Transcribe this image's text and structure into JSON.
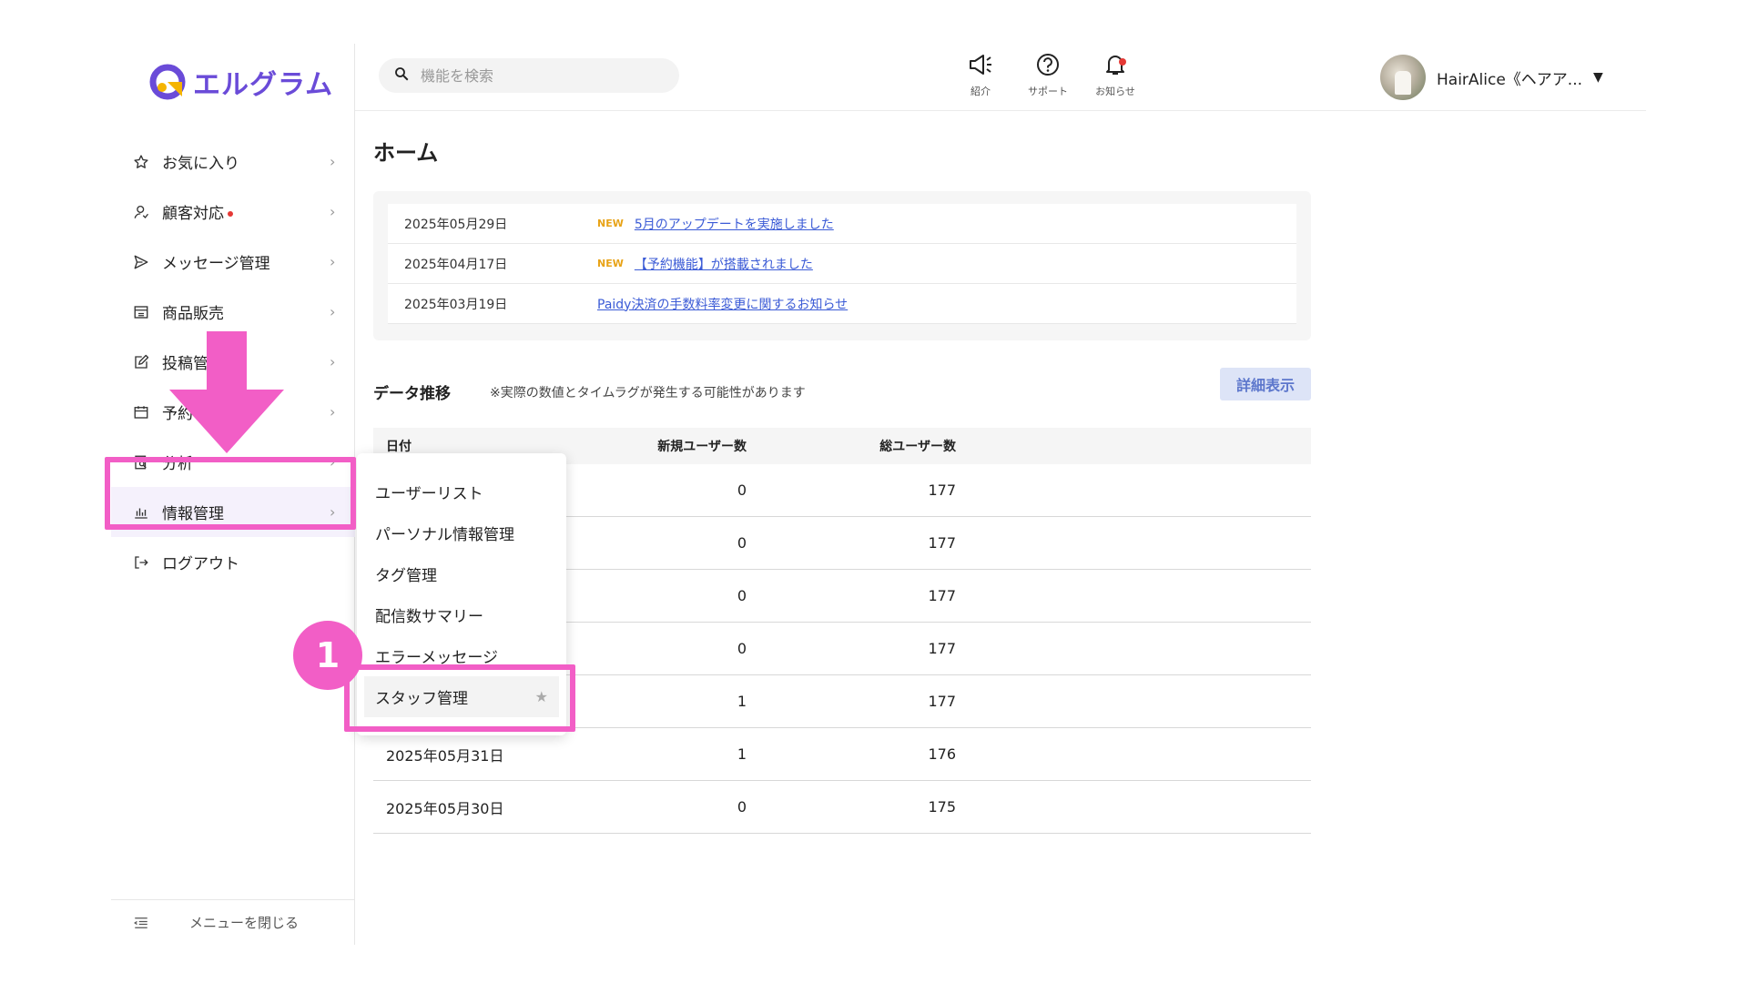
{
  "app": {
    "logo_text": "エルグラム",
    "brand_color": "#6a4bd8"
  },
  "sidebar": {
    "items": [
      {
        "label": "お気に入り",
        "icon": "star-icon"
      },
      {
        "label": "顧客対応",
        "icon": "person-icon",
        "badge": true
      },
      {
        "label": "メッセージ管理",
        "icon": "send-icon"
      },
      {
        "label": "商品販売",
        "icon": "store-icon"
      },
      {
        "label": "投稿管",
        "icon": "edit-icon"
      },
      {
        "label": "予約",
        "icon": "calendar-icon"
      },
      {
        "label": "分析",
        "icon": "report-icon"
      },
      {
        "label": "情報管理",
        "icon": "bar-chart-icon",
        "active": true
      },
      {
        "label": "ログアウト",
        "icon": "logout-icon"
      }
    ],
    "collapse_label": "メニューを閉じる"
  },
  "header": {
    "search_placeholder": "機能を検索",
    "buttons": [
      {
        "label": "紹介",
        "icon": "megaphone-icon"
      },
      {
        "label": "サポート",
        "icon": "help-icon"
      },
      {
        "label": "お知らせ",
        "icon": "bell-icon",
        "has_dot": true
      }
    ],
    "user_name": "HairAlice《ヘアア..."
  },
  "main": {
    "title": "ホーム",
    "news": [
      {
        "date": "2025年05月29日",
        "new": "NEW",
        "title": "5月のアップデートを実施しました"
      },
      {
        "date": "2025年04月17日",
        "new": "NEW",
        "title": "【予約機能】が搭載されました"
      },
      {
        "date": "2025年03月19日",
        "new": "",
        "title": "Paidy決済の手数料率変更に関するお知らせ"
      }
    ],
    "trend_title": "データ推移",
    "trend_note": "※実際の数値とタイムラグが発生する可能性があります",
    "detail_button": "詳細表示",
    "table": {
      "headers": [
        "日付",
        "新規ユーザー数",
        "総ユーザー数"
      ],
      "rows": [
        [
          "",
          "0",
          "177"
        ],
        [
          "",
          "0",
          "177"
        ],
        [
          "",
          "0",
          "177"
        ],
        [
          "",
          "0",
          "177"
        ],
        [
          "",
          "1",
          "177"
        ],
        [
          "2025年05月31日",
          "1",
          "176"
        ],
        [
          "2025年05月30日",
          "0",
          "175"
        ]
      ]
    }
  },
  "flyout": {
    "items": [
      "ユーザーリスト",
      "パーソナル情報管理",
      "タグ管理",
      "配信数サマリー",
      "エラーメッセージ",
      "スタッフ管理"
    ],
    "selected_index": 5
  },
  "overlay": {
    "step_number": "1",
    "highlight_color": "#f25ec6"
  }
}
